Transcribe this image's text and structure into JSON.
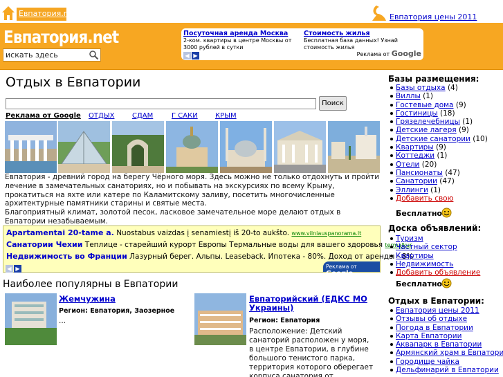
{
  "top": {
    "site_link": "Евпатория.net",
    "prices_link": "Евпатория цены 2011"
  },
  "header": {
    "logo": "Евпатория.net",
    "search_placeholder": "искать здесь",
    "ads": [
      {
        "title": "Посуточная аренда Москва",
        "text": "2-ком. квартиры в центре Москвы от 3000 рублей в сутки"
      },
      {
        "title": "Стоимость жилья",
        "text": "Бесплатная база данных! Узнай стоимость жилья"
      }
    ],
    "ads_by": "Реклама от",
    "google": "Google"
  },
  "main": {
    "title": "Отдых в Евпатории",
    "search_button": "Поиск",
    "tabs": [
      "Реклама от Google",
      "ОТДЫХ",
      "СДАМ",
      "Г САКИ",
      "КРЫМ"
    ],
    "intro_1": "Евпатория - древний город на берегу Чёрного моря. Здесь можно не только отдохнуть и пройти лечение в замечательных санаториях, но и побывать на экскурсиях по всему Крыму, прокатиться на яхте или катере по Каламитскому заливу, посетить многочисленные архитектурные памятники старины и святые места.",
    "intro_2": "Благоприятный климат, золотой песок, ласковое замечательное море делают отдых в Евпатории незабываемым.",
    "ad_box": [
      {
        "title": "Apartamentai 20-tame a.",
        "text": " Nuostabus vaizdas į senamiestį iš 20-to aukšto.",
        "url": "www.vilniauspanorama.lt"
      },
      {
        "title": "Санатории Чехии",
        "text": " Теплице - старейший курорт Европы Термальные воды для вашего здоровья",
        "url": "termalkur"
      },
      {
        "title": "Недвижимость во Франции",
        "text": " Лазурный берег. Альпы. Leaseback. Ипотека - 80%. Доход от аренды - 8%",
        "url": ""
      }
    ],
    "ad_box_by": "Реклама от",
    "ad_box_google": "Google",
    "popular_heading": "Наиболее популярны в Евпатории",
    "popular": [
      {
        "title": "Жемчужина",
        "region": "Регион: Евпатория, Заозерное",
        "desc": "..."
      },
      {
        "title": "Евпаторийский (ЕДКС МО Украины)",
        "region": "Регион: Евпатория",
        "desc": "Расположение: Детский санаторий расположен у моря, в центре Евпатории, в глубине большого тенистого парка, территория которого оберегает корпуса санатория от..."
      }
    ]
  },
  "sidebar": {
    "bases_heading": "Базы размещения:",
    "bases": [
      {
        "label": "Базы отдыха",
        "count": "(4)"
      },
      {
        "label": "Виллы",
        "count": "(1)"
      },
      {
        "label": "Гостевые дома",
        "count": "(9)"
      },
      {
        "label": "Гостиницы",
        "count": "(18)"
      },
      {
        "label": "Грязелечебницы",
        "count": "(1)"
      },
      {
        "label": "Детские лагеря",
        "count": "(9)"
      },
      {
        "label": "Детские санатории",
        "count": "(10)"
      },
      {
        "label": "Квартиры",
        "count": "(9)"
      },
      {
        "label": "Коттеджи",
        "count": "(1)"
      },
      {
        "label": "Отели",
        "count": "(20)"
      },
      {
        "label": "Пансионаты",
        "count": "(47)"
      },
      {
        "label": "Санатории",
        "count": "(47)"
      },
      {
        "label": "Эллинги",
        "count": "(1)"
      }
    ],
    "bases_add": "Добавить свою",
    "free_label": "Бесплатно",
    "board_heading": "Доска объявлений:",
    "board": [
      "Туризм",
      "Частный сектор",
      "Квартиры",
      "Недвижимость"
    ],
    "board_add": "Добавить объявление",
    "rest_heading": "Отдых в Евпатории:",
    "rest": [
      "Евпатория цены 2011",
      "Отзывы об отдыхе",
      "Погода в Евпатории",
      "Карта Евпатории",
      "Аквапарк в Евпатории",
      "Армянский храм в Евпатории",
      "Городище чайка",
      "Дельфинарий в Евпатории"
    ]
  }
}
